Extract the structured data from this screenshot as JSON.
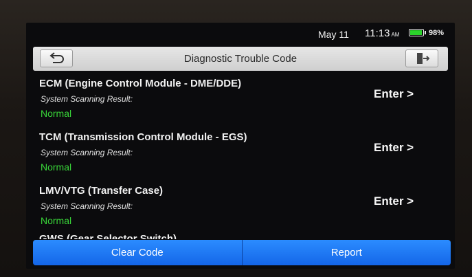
{
  "status_bar": {
    "date": "May 11",
    "time": "11:13",
    "ampm": "AM",
    "battery": "98%",
    "battery_level": 0.98
  },
  "header": {
    "title": "Diagnostic Trouble Code",
    "back_icon": "back-arrow-icon",
    "exit_icon": "exit-door-icon"
  },
  "modules": [
    {
      "name": "ECM (Engine Control Module - DME/DDE)",
      "subtitle": "System Scanning Result:",
      "status": "Normal",
      "action": "Enter >"
    },
    {
      "name": "TCM (Transmission Control Module - EGS)",
      "subtitle": "System Scanning Result:",
      "status": "Normal",
      "action": "Enter >"
    },
    {
      "name": "LMV/VTG (Transfer Case)",
      "subtitle": "System Scanning Result:",
      "status": "Normal",
      "action": "Enter >"
    },
    {
      "name": "GWS (Gear Selector Switch)"
    }
  ],
  "footer": {
    "clear_label": "Clear Code",
    "report_label": "Report"
  },
  "colors": {
    "status_normal": "#39d639",
    "accent_blue": "#1e78f5",
    "header_bg": "#dcdcdc"
  }
}
